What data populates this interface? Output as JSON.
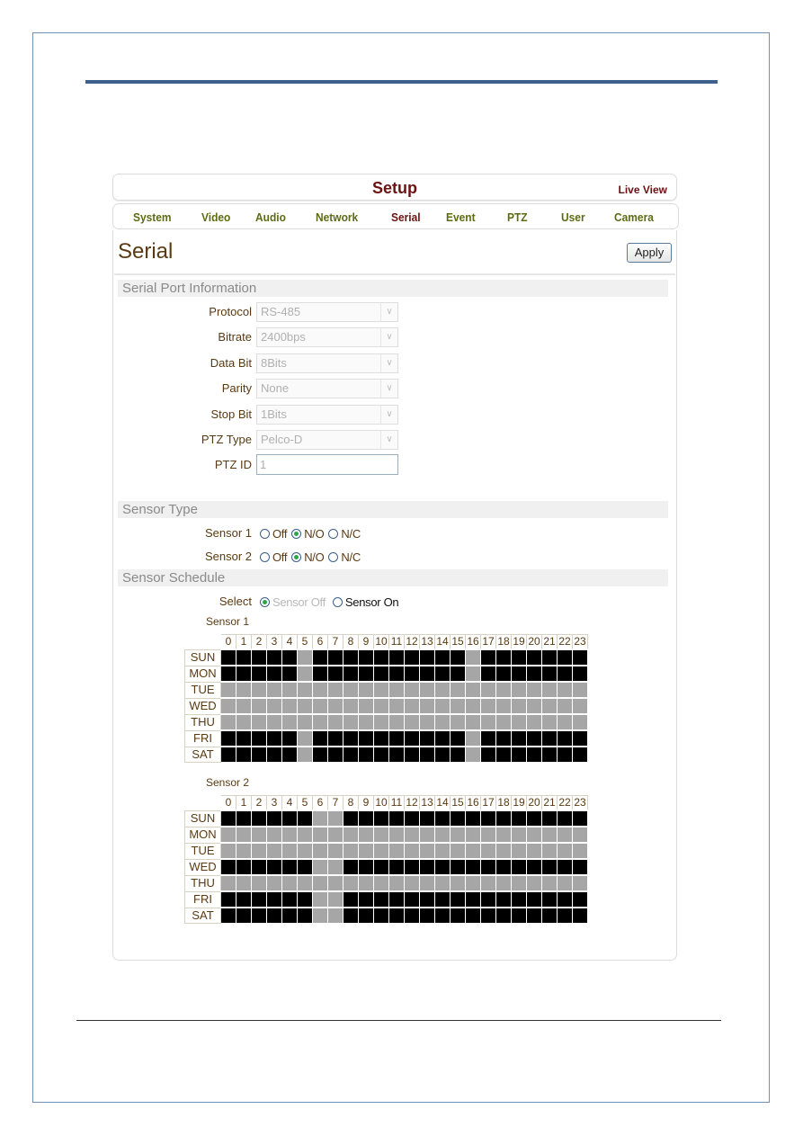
{
  "header": {
    "title": "Setup",
    "live_view": "Live View"
  },
  "tabs": [
    {
      "label": "System",
      "active": false
    },
    {
      "label": "Video",
      "active": false
    },
    {
      "label": "Audio",
      "active": false
    },
    {
      "label": "Network",
      "active": false
    },
    {
      "label": "Serial",
      "active": true
    },
    {
      "label": "Event",
      "active": false
    },
    {
      "label": "PTZ",
      "active": false
    },
    {
      "label": "User",
      "active": false
    },
    {
      "label": "Camera",
      "active": false
    }
  ],
  "page": {
    "title": "Serial",
    "apply_label": "Apply"
  },
  "serial_port": {
    "heading": "Serial Port Information",
    "fields": [
      {
        "label": "Protocol",
        "type": "select",
        "value": "RS-485"
      },
      {
        "label": "Bitrate",
        "type": "select",
        "value": "2400bps"
      },
      {
        "label": "Data Bit",
        "type": "select",
        "value": "8Bits"
      },
      {
        "label": "Parity",
        "type": "select",
        "value": "None"
      },
      {
        "label": "Stop Bit",
        "type": "select",
        "value": "1Bits"
      },
      {
        "label": "PTZ Type",
        "type": "select",
        "value": "Pelco-D"
      },
      {
        "label": "PTZ ID",
        "type": "text",
        "value": "1"
      }
    ]
  },
  "sensor_type": {
    "heading": "Sensor Type",
    "options": [
      "Off",
      "N/O",
      "N/C"
    ],
    "sensors": [
      {
        "label": "Sensor 1",
        "selected": "N/O"
      },
      {
        "label": "Sensor 2",
        "selected": "N/O"
      }
    ]
  },
  "sensor_schedule": {
    "heading": "Sensor Schedule",
    "select_label": "Select",
    "select_options": [
      "Sensor Off",
      "Sensor On"
    ],
    "select_value": "Sensor Off",
    "hours": [
      "0",
      "1",
      "2",
      "3",
      "4",
      "5",
      "6",
      "7",
      "8",
      "9",
      "10",
      "11",
      "12",
      "13",
      "14",
      "15",
      "16",
      "17",
      "18",
      "19",
      "20",
      "21",
      "22",
      "23"
    ],
    "days": [
      "SUN",
      "MON",
      "TUE",
      "WED",
      "THU",
      "FRI",
      "SAT"
    ],
    "grids": [
      {
        "label": "Sensor 1",
        "on_days": [
          "SUN",
          "MON",
          "FRI",
          "SAT"
        ],
        "off_hours_on_active_days": [
          5,
          16
        ]
      },
      {
        "label": "Sensor 2",
        "on_days": [
          "SUN",
          "WED",
          "FRI",
          "SAT"
        ],
        "off_hours_on_active_days": [
          6,
          7
        ]
      }
    ]
  }
}
